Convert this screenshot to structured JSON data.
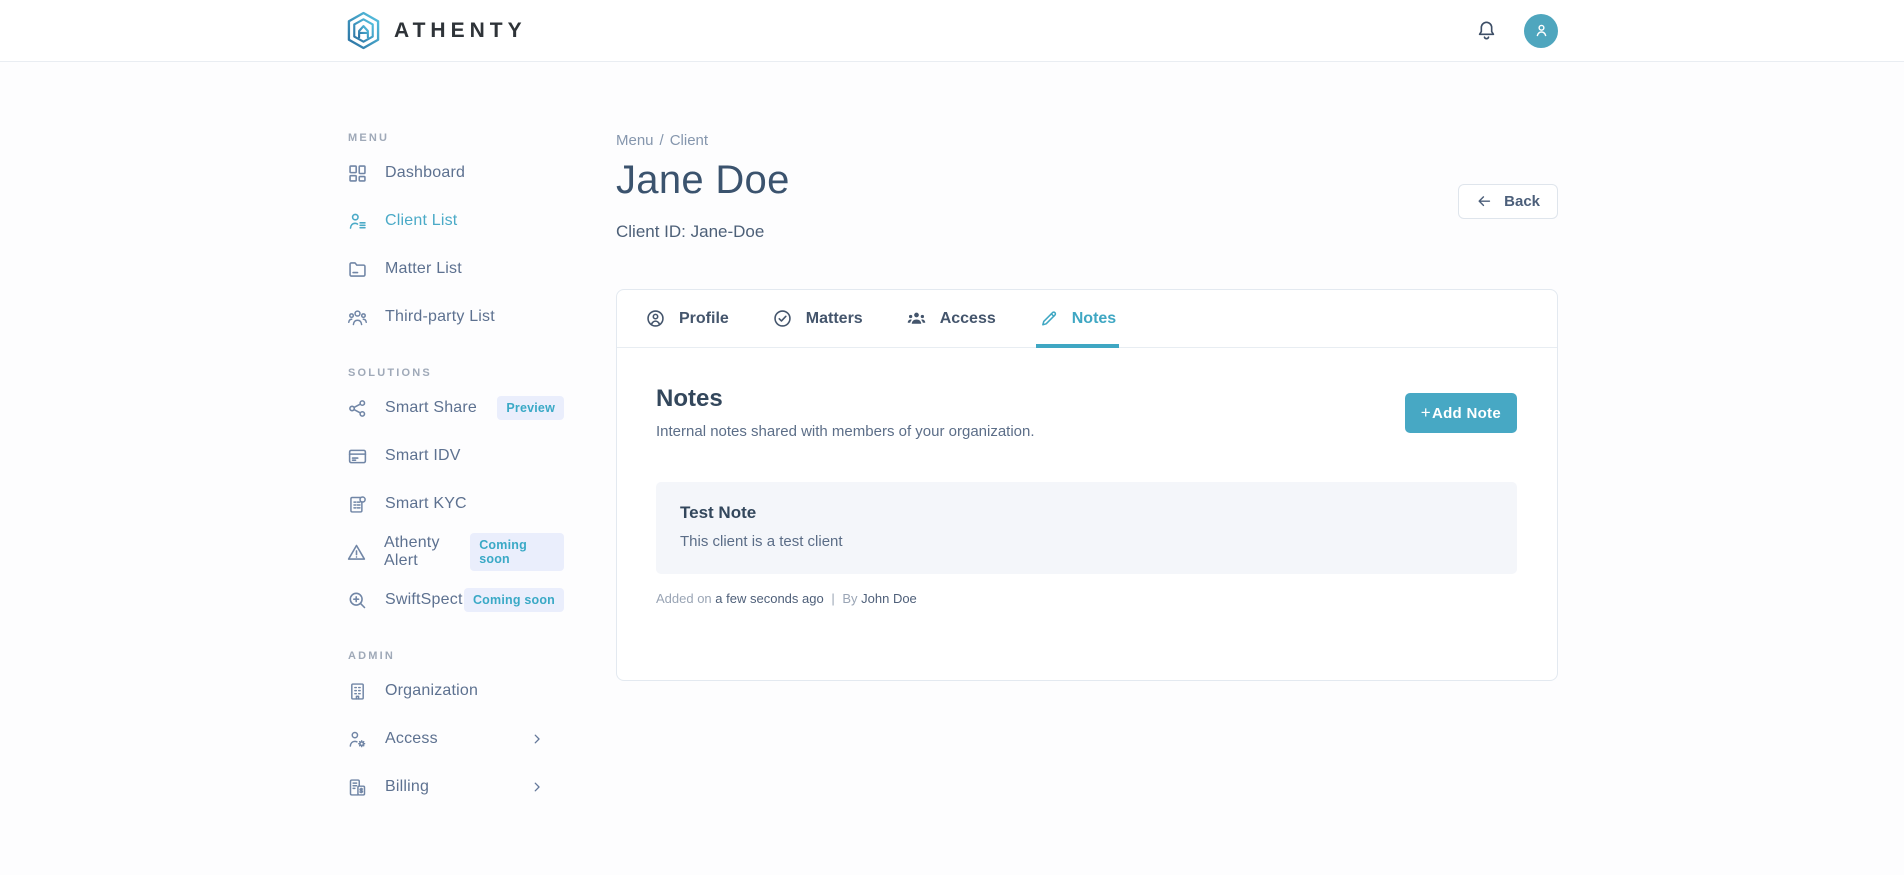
{
  "colors": {
    "accent": "#3FA7C3",
    "avatar_bg": "#4FA6BE",
    "badge_bg": "#EAEEFC",
    "badge_text": "#3AA9C6"
  },
  "header": {
    "brand": "ATHENTY",
    "logo_icon": "athenty-hexagon-logo",
    "bell_icon": "notification-bell",
    "avatar_icon": "user-avatar"
  },
  "sidebar": {
    "sections": [
      {
        "label": "MENU",
        "items": [
          {
            "label": "Dashboard",
            "icon": "dashboard-grid-icon",
            "active": false
          },
          {
            "label": "Client List",
            "icon": "client-list-icon",
            "active": true
          },
          {
            "label": "Matter List",
            "icon": "folder-icon",
            "active": false
          },
          {
            "label": "Third-party List",
            "icon": "people-group-icon",
            "active": false
          }
        ]
      },
      {
        "label": "SOLUTIONS",
        "items": [
          {
            "label": "Smart Share",
            "icon": "share-icon",
            "badge": "Preview"
          },
          {
            "label": "Smart IDV",
            "icon": "id-card-icon"
          },
          {
            "label": "Smart KYC",
            "icon": "document-check-icon"
          },
          {
            "label": "Athenty Alert",
            "icon": "warning-triangle-icon",
            "badge": "Coming soon"
          },
          {
            "label": "SwiftSpect",
            "icon": "magnifier-plus-icon",
            "badge": "Coming soon"
          }
        ]
      },
      {
        "label": "ADMIN",
        "items": [
          {
            "label": "Organization",
            "icon": "building-icon"
          },
          {
            "label": "Access",
            "icon": "user-gear-icon",
            "chevron": true
          },
          {
            "label": "Billing",
            "icon": "billing-receipt-icon",
            "chevron": true
          }
        ]
      }
    ]
  },
  "main": {
    "breadcrumb": {
      "menu": "Menu",
      "separator": "/",
      "client": "Client"
    },
    "title": "Jane Doe",
    "client_id": "Client ID: Jane-Doe",
    "back_label": "Back",
    "tabs": [
      {
        "label": "Profile",
        "icon": "user-circle-icon",
        "active": false
      },
      {
        "label": "Matters",
        "icon": "check-circle-icon",
        "active": false
      },
      {
        "label": "Access",
        "icon": "users-icon",
        "active": false
      },
      {
        "label": "Notes",
        "icon": "pencil-icon",
        "active": true
      }
    ],
    "notes": {
      "heading": "Notes",
      "subheading": "Internal notes shared with members of your organization.",
      "add_plus": "+",
      "add_label": "Add Note",
      "note": {
        "title": "Test Note",
        "body": "This client is a test client"
      },
      "meta": {
        "added_on": "Added on",
        "time": "a few seconds ago",
        "separator": "|",
        "by": "By",
        "author": "John Doe"
      }
    }
  }
}
